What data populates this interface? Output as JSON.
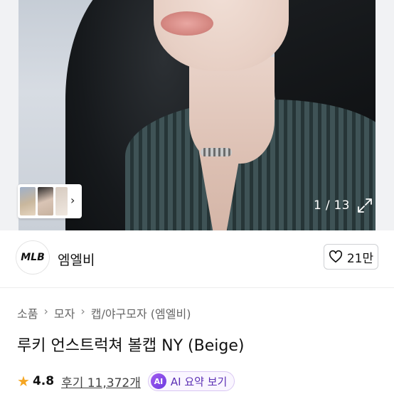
{
  "gallery": {
    "counter": "1 / 13"
  },
  "seller": {
    "logo_text": "MLB",
    "name": "엠엘비",
    "like_count": "21만"
  },
  "breadcrumb": [
    "소품",
    "모자",
    "캡/야구모자 (엠엘비)"
  ],
  "product": {
    "title": "루키 언스트럭쳐 볼캡 NY (Beige)",
    "rating": "4.8",
    "reviews_label": "후기 11,372개",
    "ai_badge": "AI",
    "ai_summary_label": "AI 요약 보기"
  },
  "colors": {
    "star": "#f5a623",
    "ai_accent": "#6c3be0"
  }
}
